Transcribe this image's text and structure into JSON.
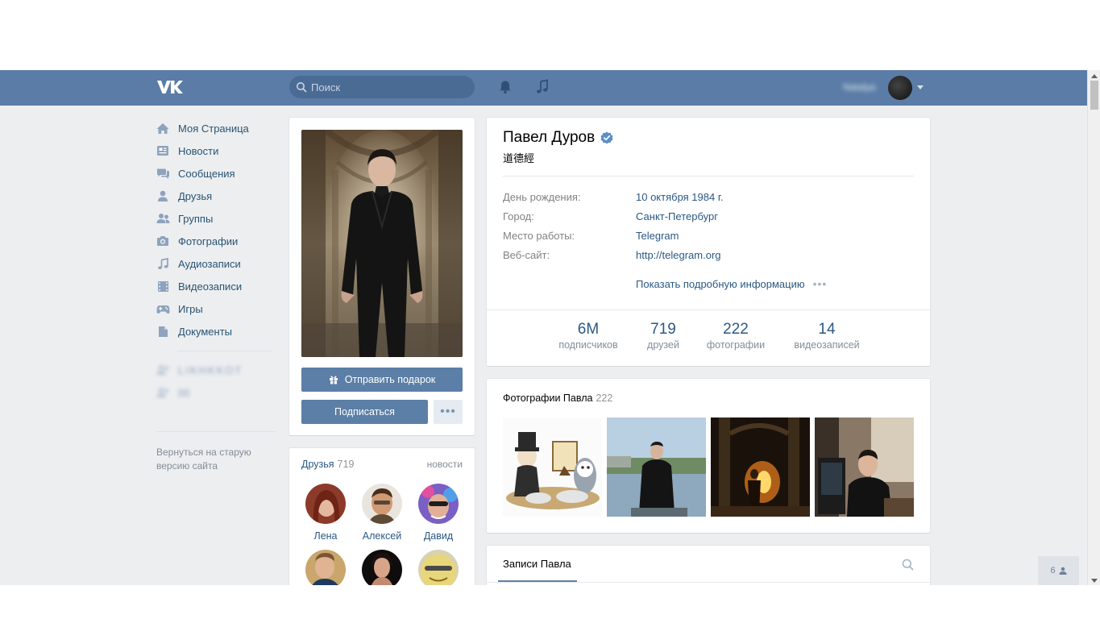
{
  "header": {
    "logo": "vk-logo",
    "search_placeholder": "Поиск",
    "user_name": "Natalya"
  },
  "nav": {
    "items": [
      {
        "label": "Моя Страница",
        "icon": "home-icon"
      },
      {
        "label": "Новости",
        "icon": "news-icon"
      },
      {
        "label": "Сообщения",
        "icon": "messages-icon"
      },
      {
        "label": "Друзья",
        "icon": "friends-icon"
      },
      {
        "label": "Группы",
        "icon": "groups-icon"
      },
      {
        "label": "Фотографии",
        "icon": "camera-icon"
      },
      {
        "label": "Аудиозаписи",
        "icon": "music-icon"
      },
      {
        "label": "Видеозаписи",
        "icon": "video-icon"
      },
      {
        "label": "Игры",
        "icon": "gamepad-icon"
      },
      {
        "label": "Документы",
        "icon": "document-icon"
      }
    ],
    "groups": [
      {
        "label": "LIKHKKOT",
        "icon": "group-icon"
      },
      {
        "label": "00",
        "icon": "group-icon"
      }
    ],
    "old_version": "Вернуться на старую версию сайта"
  },
  "profile": {
    "gift_button": "Отправить подарок",
    "subscribe_button": "Подписаться",
    "more_button": "•••"
  },
  "friends": {
    "title": "Друзья",
    "count": "719",
    "news_link": "новости",
    "list": [
      {
        "name": "Лена"
      },
      {
        "name": "Алексей"
      },
      {
        "name": "Давид"
      },
      {
        "name": ""
      },
      {
        "name": ""
      },
      {
        "name": ""
      }
    ]
  },
  "info": {
    "name": "Павел Дуров",
    "status": "道德經",
    "rows": [
      {
        "label": "День рождения:",
        "value": "10 октября 1984 г."
      },
      {
        "label": "Город:",
        "value": "Санкт-Петербург"
      },
      {
        "label": "Место работы:",
        "value": "Telegram"
      },
      {
        "label": "Веб-сайт:",
        "value": "http://telegram.org"
      }
    ],
    "more_info": "Показать подробную информацию",
    "more_dots": "•••",
    "counters": [
      {
        "num": "6M",
        "label": "подписчиков"
      },
      {
        "num": "719",
        "label": "друзей"
      },
      {
        "num": "222",
        "label": "фотографии"
      },
      {
        "num": "14",
        "label": "видеозаписей"
      }
    ]
  },
  "photos": {
    "title": "Фотографии Павла",
    "count": "222"
  },
  "posts": {
    "tab": "Записи Павла"
  },
  "online": {
    "count": "6"
  },
  "colors": {
    "header": "#5a7ca6",
    "button": "#5b7fa6",
    "link": "#2a5885",
    "background": "#edeef0"
  }
}
